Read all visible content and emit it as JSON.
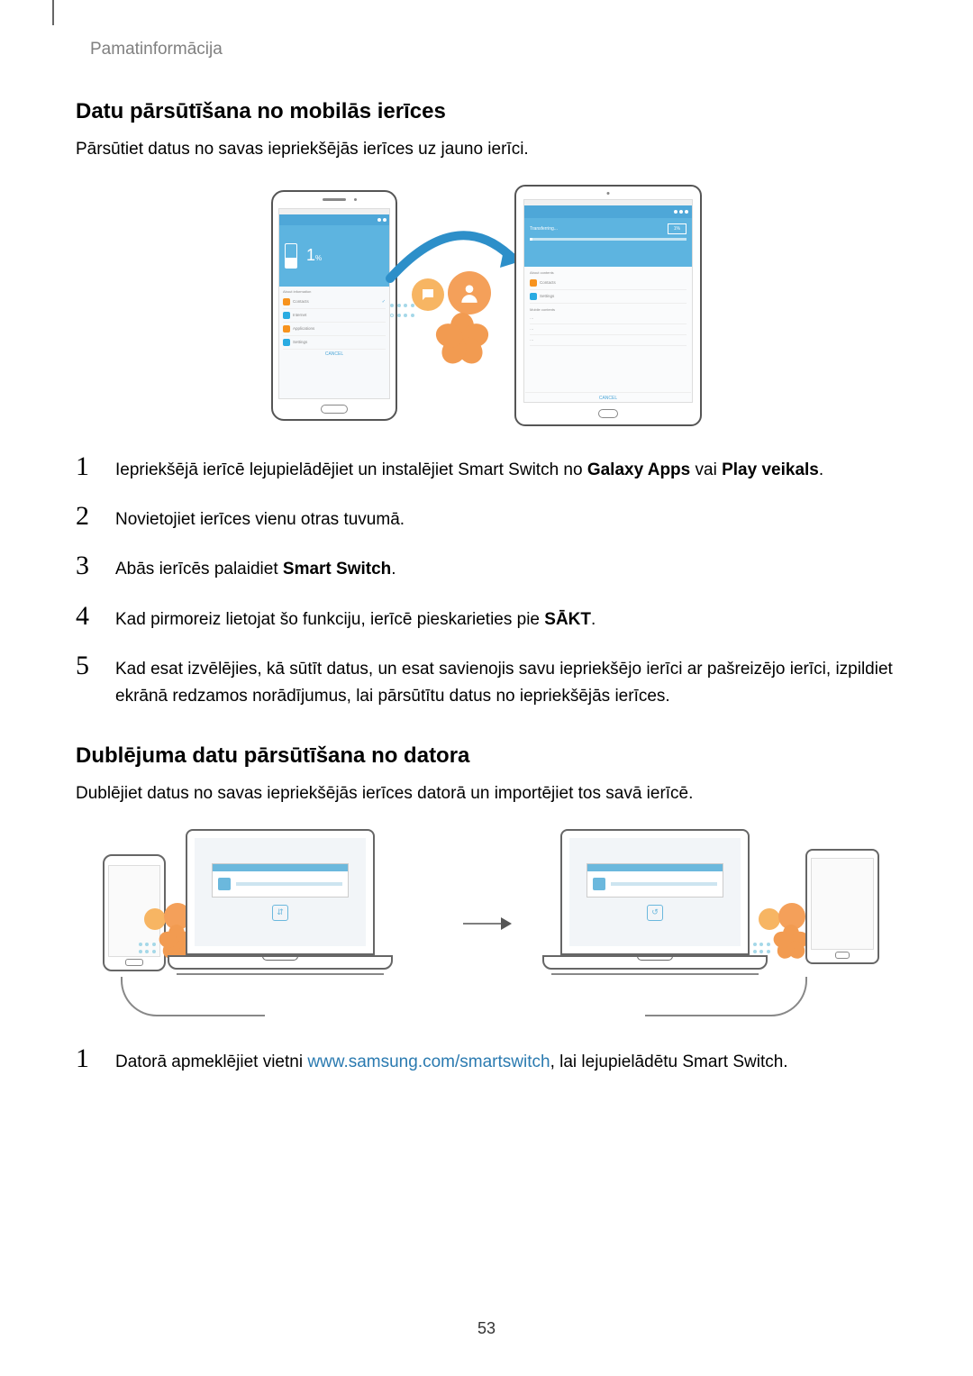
{
  "breadcrumb": "Pamatinformācija",
  "section1": {
    "heading": "Datu pārsūtīšana no mobilās ierīces",
    "intro": "Pārsūtiet datus no savas iepriekšējās ierīces uz jauno ierīci.",
    "phone_screen": {
      "percent": "1",
      "percent_unit": "%",
      "section_label": "About information",
      "rows": [
        {
          "icon": "orange",
          "title": "Contacts",
          "checked": true
        },
        {
          "icon": "blue",
          "title": "Internet",
          "checked": false
        },
        {
          "icon": "orange",
          "title": "Applications",
          "checked": false
        },
        {
          "icon": "blue",
          "title": "Settings",
          "checked": false
        }
      ],
      "cancel": "CANCEL"
    },
    "tablet_screen": {
      "transferring": "Transferring...",
      "percent": "1%",
      "section_label": "About contents",
      "rows": [
        {
          "icon": "orange",
          "title": "Contacts"
        },
        {
          "icon": "blue",
          "title": "Settings"
        }
      ],
      "mobile_label": "Mobile contents",
      "cancel": "CANCEL"
    },
    "steps": [
      {
        "n": "1",
        "html_parts": [
          "Iepriekšējā ierīcē lejupielādējiet un instalējiet Smart Switch no ",
          "Galaxy Apps",
          " vai ",
          "Play veikals",
          "."
        ]
      },
      {
        "n": "2",
        "text": "Novietojiet ierīces vienu otras tuvumā."
      },
      {
        "n": "3",
        "html_parts": [
          "Abās ierīcēs palaidiet ",
          "Smart Switch",
          "."
        ]
      },
      {
        "n": "4",
        "html_parts": [
          "Kad pirmoreiz lietojat šo funkciju, ierīcē pieskarieties pie ",
          "SĀKT",
          "."
        ]
      },
      {
        "n": "5",
        "text": "Kad esat izvēlējies, kā sūtīt datus, un esat savienojis savu iepriekšējo ierīci ar pašreizējo ierīci, izpildiet ekrānā redzamos norādījumus, lai pārsūtītu datus no iepriekšējās ierīces."
      }
    ]
  },
  "section2": {
    "heading": "Dublējuma datu pārsūtīšana no datora",
    "intro": "Dublējiet datus no savas iepriekšējās ierīces datorā un importējiet tos savā ierīcē.",
    "step1": {
      "n": "1",
      "before": "Datorā apmeklējiet vietni ",
      "link_text": "www.samsung.com/smartswitch",
      "link_href": "http://www.samsung.com/smartswitch",
      "after": ", lai lejupielādētu Smart Switch."
    }
  },
  "page_number": "53"
}
